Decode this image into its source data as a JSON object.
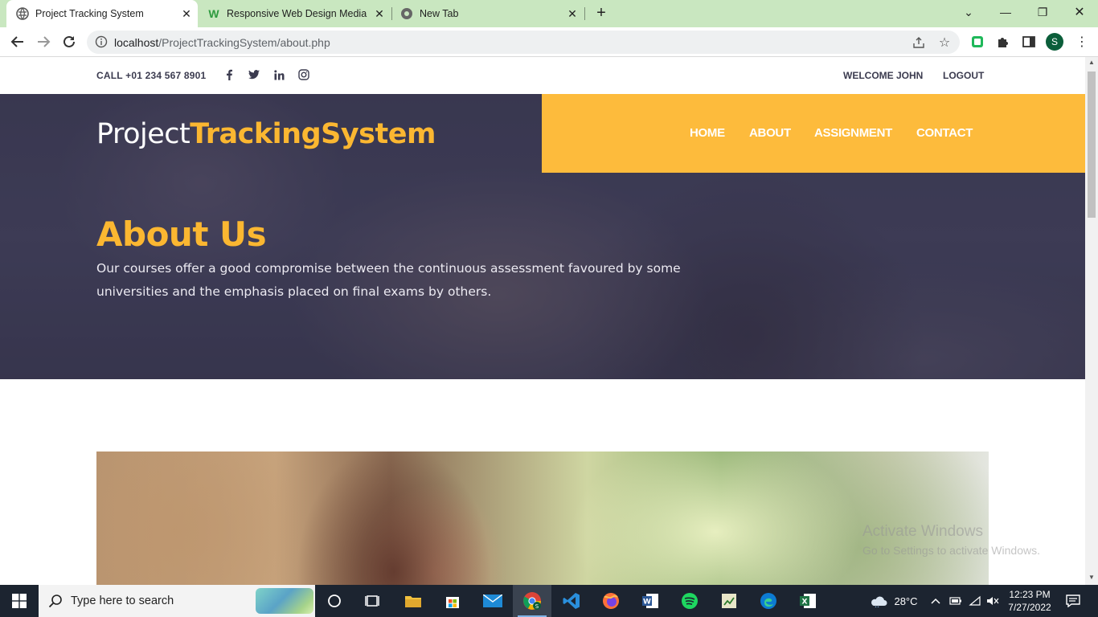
{
  "browser": {
    "tabs": [
      {
        "title": "Project Tracking System",
        "active": true
      },
      {
        "title": "Responsive Web Design Media Q"
      },
      {
        "title": "New Tab"
      }
    ],
    "url_host": "localhost",
    "url_path": "/ProjectTrackingSystem/about.php",
    "profile_initial": "S"
  },
  "topbar": {
    "call": "CALL +01 234 567 8901",
    "welcome": "WELCOME JOHN",
    "logout": "LOGOUT"
  },
  "header": {
    "brand_plain": "Project",
    "brand_accent": "TrackingSystem",
    "nav": [
      "HOME",
      "ABOUT",
      "ASSIGNMENT",
      "CONTACT"
    ]
  },
  "hero": {
    "title": "About Us",
    "text": "Our courses offer a good compromise between the continuous assessment favoured by some universities and the emphasis placed on final exams by others."
  },
  "watermark": {
    "line1": "Activate Windows",
    "line2": "Go to Settings to activate Windows."
  },
  "taskbar": {
    "search_placeholder": "Type here to search",
    "weather": "28°C",
    "time": "12:23 PM",
    "date": "7/27/2022"
  },
  "colors": {
    "accent": "#fbb731",
    "nav_bg": "#fdbb3c",
    "tab_strip": "#c9e7c0",
    "hero_bg": "#42415a"
  }
}
